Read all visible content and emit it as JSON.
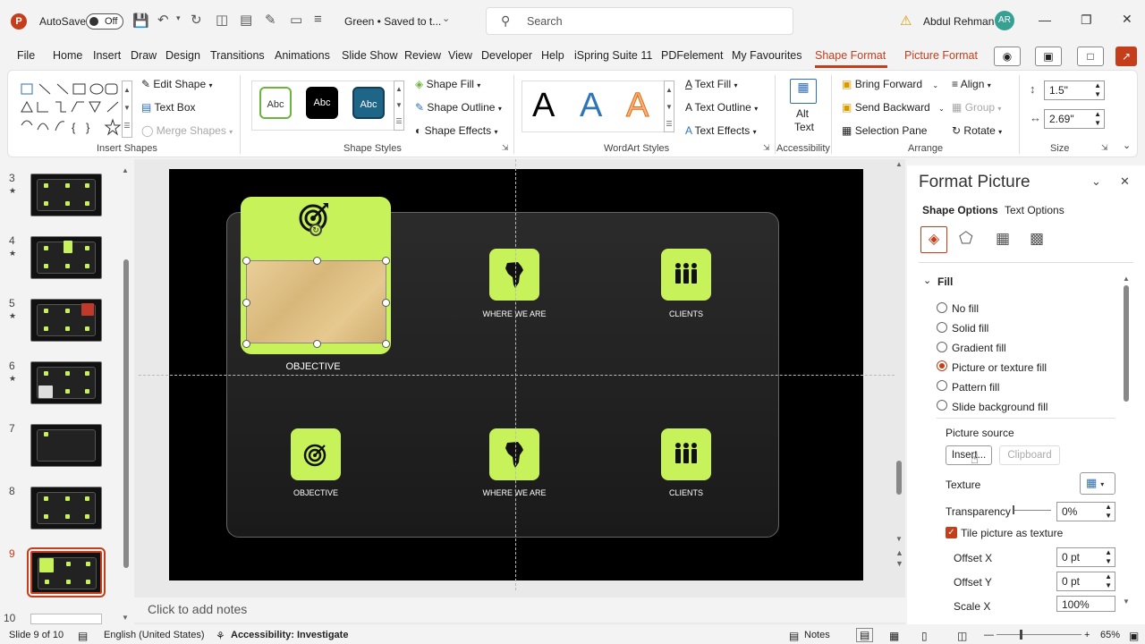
{
  "app": {
    "logo": "P",
    "autosave_label": "AutoSave",
    "autosave_state": "Off",
    "doc_title": "Green • Saved to t...",
    "search_placeholder": "Search",
    "user_name": "Abdul Rehman",
    "user_initials": "AR",
    "accent": "#c43e1c"
  },
  "menu": {
    "items": [
      "File",
      "Home",
      "Insert",
      "Draw",
      "Design",
      "Transitions",
      "Animations",
      "Slide Show",
      "Review",
      "View",
      "Developer",
      "Help",
      "iSpring Suite 11",
      "PDFelement",
      "My Favourites",
      "Shape Format",
      "Picture Format"
    ],
    "active": "Shape Format"
  },
  "ribbon": {
    "insert_shapes": {
      "label": "Insert Shapes",
      "edit_shape": "Edit Shape",
      "text_box": "Text Box",
      "merge_shapes": "Merge Shapes"
    },
    "shape_styles": {
      "label": "Shape Styles",
      "swatch1": "Abc",
      "swatch2": "Abc",
      "swatch3": "Abc",
      "shape_fill": "Shape Fill",
      "shape_outline": "Shape Outline",
      "shape_effects": "Shape Effects"
    },
    "wordart": {
      "label": "WordArt Styles",
      "a1": "A",
      "a2": "A",
      "a3": "A",
      "text_fill": "Text Fill",
      "text_outline": "Text Outline",
      "text_effects": "Text Effects"
    },
    "accessibility": {
      "label": "Accessibility",
      "alt_text_1": "Alt",
      "alt_text_2": "Text"
    },
    "arrange": {
      "label": "Arrange",
      "bring_forward": "Bring Forward",
      "send_backward": "Send Backward",
      "selection_pane": "Selection Pane",
      "align": "Align",
      "group": "Group",
      "rotate": "Rotate"
    },
    "size": {
      "label": "Size",
      "height": "1.5\"",
      "width": "2.69\""
    }
  },
  "thumbnails": {
    "numbers": [
      "3",
      "4",
      "5",
      "6",
      "7",
      "8",
      "9",
      "10"
    ],
    "selected": "9"
  },
  "slide": {
    "big_card_caption": "OBJECTIVE",
    "top_cards": [
      {
        "caption": "WHERE WE ARE",
        "icon": "africa-icon"
      },
      {
        "caption": "CLIENTS",
        "icon": "people-icon"
      }
    ],
    "bottom_cards": [
      {
        "caption": "OBJECTIVE",
        "icon": "target-icon"
      },
      {
        "caption": "WHERE WE ARE",
        "icon": "africa-icon"
      },
      {
        "caption": "CLIENTS",
        "icon": "people-icon"
      }
    ],
    "card_color": "#c7f25a"
  },
  "notes_placeholder": "Click to add notes",
  "format_pane": {
    "title": "Format Picture",
    "tab_shape": "Shape Options",
    "tab_text": "Text Options",
    "section": "Fill",
    "fill_options": [
      "No fill",
      "Solid fill",
      "Gradient fill",
      "Picture or texture fill",
      "Pattern fill",
      "Slide background fill"
    ],
    "selected_fill": "Picture or texture fill",
    "picture_source": "Picture source",
    "insert_btn": "Insert...",
    "clipboard_btn": "Clipboard",
    "texture": "Texture",
    "transparency": "Transparency",
    "transparency_value": "0%",
    "tile": "Tile picture as texture",
    "offset_x": "Offset X",
    "offset_x_value": "0 pt",
    "offset_y": "Offset Y",
    "offset_y_value": "0 pt",
    "scale_x": "Scale X",
    "scale_x_value": "100%"
  },
  "status": {
    "slide": "Slide 9 of 10",
    "language": "English (United States)",
    "accessibility": "Accessibility: Investigate",
    "notes": "Notes",
    "zoom": "65%"
  }
}
